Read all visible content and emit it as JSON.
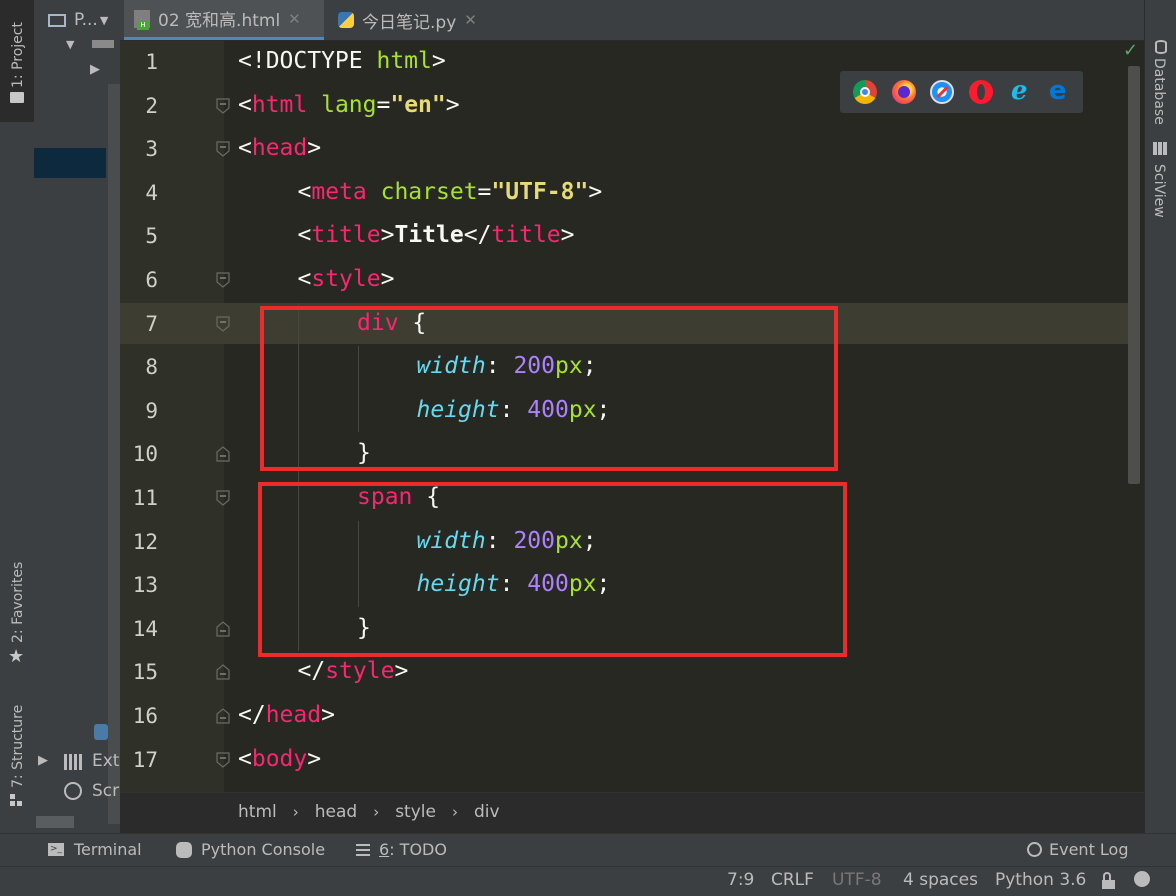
{
  "left_strip": {
    "project": "1: Project",
    "favorites": "2: Favorites",
    "structure": "7: Structure"
  },
  "project_panel": {
    "title": "P...",
    "items": [
      "Ext",
      "Scr"
    ]
  },
  "tabs": [
    {
      "label": "02 宽和高.html",
      "icon": "html-file-icon",
      "active": true
    },
    {
      "label": "今日笔记.py",
      "icon": "python-file-icon",
      "active": false
    }
  ],
  "right_strip": {
    "database": "Database",
    "sciview": "SciView"
  },
  "code_lines": [
    {
      "n": "1"
    },
    {
      "n": "2"
    },
    {
      "n": "3"
    },
    {
      "n": "4"
    },
    {
      "n": "5"
    },
    {
      "n": "6"
    },
    {
      "n": "7"
    },
    {
      "n": "8"
    },
    {
      "n": "9"
    },
    {
      "n": "10"
    },
    {
      "n": "11"
    },
    {
      "n": "12"
    },
    {
      "n": "13"
    },
    {
      "n": "14"
    },
    {
      "n": "15"
    },
    {
      "n": "16"
    },
    {
      "n": "17"
    }
  ],
  "code": {
    "l1": [
      "<!DOCTYPE ",
      "html",
      ">"
    ],
    "l2": [
      "<",
      "html",
      " ",
      "lang",
      "=",
      "\"en\"",
      ">"
    ],
    "l3": [
      "<",
      "head",
      ">"
    ],
    "l4": [
      "<",
      "meta",
      " ",
      "charset",
      "=",
      "\"UTF-8\"",
      ">"
    ],
    "l5": [
      "<",
      "title",
      ">",
      "Title",
      "</",
      "title",
      ">"
    ],
    "l6": [
      "<",
      "style",
      ">"
    ],
    "l7": [
      "div",
      " {"
    ],
    "l8": [
      "width",
      ": ",
      "200",
      "px",
      ";"
    ],
    "l9": [
      "height",
      ": ",
      "400",
      "px",
      ";"
    ],
    "l10": [
      "}"
    ],
    "l11": [
      "span",
      " {"
    ],
    "l12": [
      "width",
      ": ",
      "200",
      "px",
      ";"
    ],
    "l13": [
      "height",
      ": ",
      "400",
      "px",
      ";"
    ],
    "l14": [
      "}"
    ],
    "l15": [
      "</",
      "style",
      ">"
    ],
    "l16": [
      "</",
      "head",
      ">"
    ],
    "l17": [
      "<",
      "body",
      ">"
    ]
  },
  "browsers": [
    "chrome-icon",
    "firefox-icon",
    "safari-icon",
    "opera-icon",
    "ie-icon",
    "edge-icon"
  ],
  "breadcrumb": [
    "html",
    "head",
    "style",
    "div"
  ],
  "tool_windows": {
    "terminal": "Terminal",
    "python_console": "Python Console",
    "todo_num": "6",
    "todo": ": TODO",
    "event_log": "Event Log"
  },
  "status": {
    "position": "7:9",
    "line_sep": "CRLF",
    "encoding": "UTF-8",
    "indent": "4 spaces",
    "interpreter": "Python 3.6"
  },
  "colors": {
    "editor_bg": "#272822",
    "tag": "#f92672",
    "attr": "#a6e22e",
    "string": "#e6db74",
    "property": "#66d9ef",
    "number": "#ae81ff",
    "highlight_box": "#ee2b2b"
  }
}
